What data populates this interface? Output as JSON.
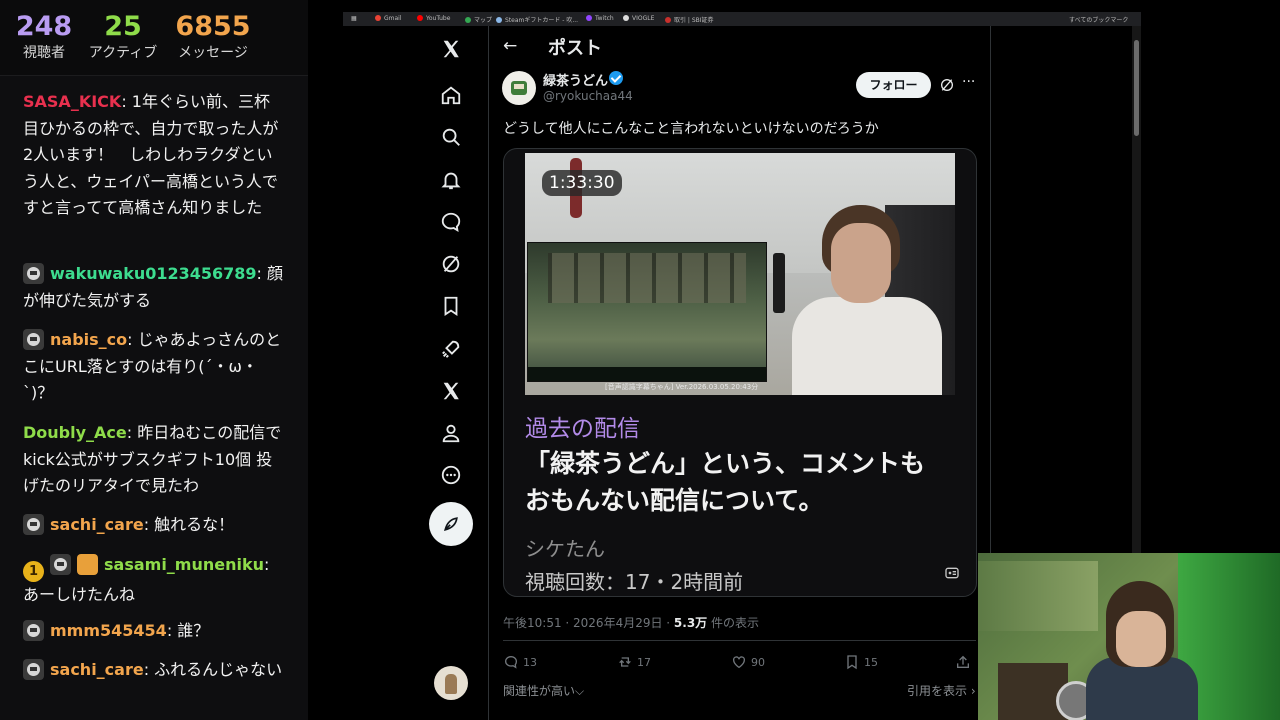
{
  "stream_stats": {
    "viewers": {
      "value": "248",
      "label": "視聴者",
      "color": "#b99cf2"
    },
    "active": {
      "value": "25",
      "label": "アクティブ",
      "color": "#8fdc4a"
    },
    "messages": {
      "value": "6855",
      "label": "メッセージ",
      "color": "#f2a54d"
    }
  },
  "chat": [
    {
      "user": "SASA_KICK",
      "user_color": "#e8304e",
      "badges": [],
      "text": ": 1年ぐらい前、三杯目ひかるの枠で、自力で取った人が2人います！　しわしわラクダという人と、ウェイパー高橋という人ですと言ってて高橋さん知りました"
    },
    {
      "user": "wakuwaku0123456789",
      "user_color": "#3ddc8f",
      "badges": [
        "kitty-icon"
      ],
      "text": ": 顔が伸びた気がする"
    },
    {
      "user": "nabis_co",
      "user_color": "#f2a54d",
      "badges": [
        "kitty-icon"
      ],
      "text": ": じゃあよっさんのとこにURL落とすのは有り(´・ω・`)？"
    },
    {
      "user": "Doubly_Ace",
      "user_color": "#8fdc4a",
      "badges": [],
      "text": ": 昨日ねむこの配信でkick公式がサブスクギフト10個 投げたのリアタイで見たわ"
    },
    {
      "user": "sachi_care",
      "user_color": "#f2a54d",
      "badges": [
        "kitty-icon"
      ],
      "text": ": 触れるな！"
    },
    {
      "user": "sasami_muneniku",
      "user_color": "#8fdc4a",
      "badges": [
        "sub-1-icon",
        "kitty-icon",
        "gift-icon"
      ],
      "badge_number": "1",
      "text": ": あーしけたんね"
    },
    {
      "user": "mmm545454",
      "user_color": "#f2a54d",
      "badges": [
        "kitty-icon"
      ],
      "text": ": 誰？"
    },
    {
      "user": "sachi_care",
      "user_color": "#f2a54d",
      "badges": [
        "kitty-icon"
      ],
      "text": ": ふれるんじゃない"
    }
  ],
  "browser": {
    "bookmarks": [
      {
        "label": "Gmail",
        "color": "#ea4335"
      },
      {
        "label": "YouTube",
        "color": "#ff0000"
      },
      {
        "label": "マップ",
        "color": "#34a853"
      },
      {
        "label": "Steamギフトカード - 吹...",
        "color": "#8bb8e8"
      },
      {
        "label": "Twitch",
        "color": "#9146ff"
      },
      {
        "label": "VIOGLE",
        "color": "#dddddd"
      },
      {
        "label": "取引 | SBI証券",
        "color": "#c9302c"
      }
    ],
    "all_bookmarks": "すべてのブックマーク"
  },
  "x_nav": {
    "items": [
      "x-logo-icon",
      "home-icon",
      "search-icon",
      "bell-icon",
      "message-icon",
      "grok-icon",
      "bookmark-icon",
      "rocket-icon",
      "x-premium-icon",
      "profile-icon",
      "more-circle-icon",
      "post-compose-icon"
    ]
  },
  "post": {
    "header_title": "ポスト",
    "back_icon": "back-arrow-icon",
    "author_name": "緑茶うどん",
    "handle": "@ryokuchaa44",
    "verified": true,
    "follow_label": "フォロー",
    "text": "どうして他人にこんなこと言われないといけないのだろうか",
    "card": {
      "duration": "1:33:30",
      "category": "過去の配信",
      "title": "「緑茶うどん」という、コメントもおもんない配信について。",
      "channel": "シケたん",
      "views": "視聴回数：17・2時間前",
      "thumb_overlay_text": "[音声認識字幕ちゃん] Ver.2026.03.05.20:43分"
    },
    "meta": {
      "time": "午後10:51 · 2026年4月29日 · ",
      "views_count": "5.3万",
      "views_label": " 件の表示"
    },
    "actions": {
      "replies": "13",
      "reposts": "17",
      "likes": "90",
      "bookmarks": "15"
    },
    "relevance_label": "関連性が高い⌵",
    "quotes_label": "引用を表示 ›"
  }
}
